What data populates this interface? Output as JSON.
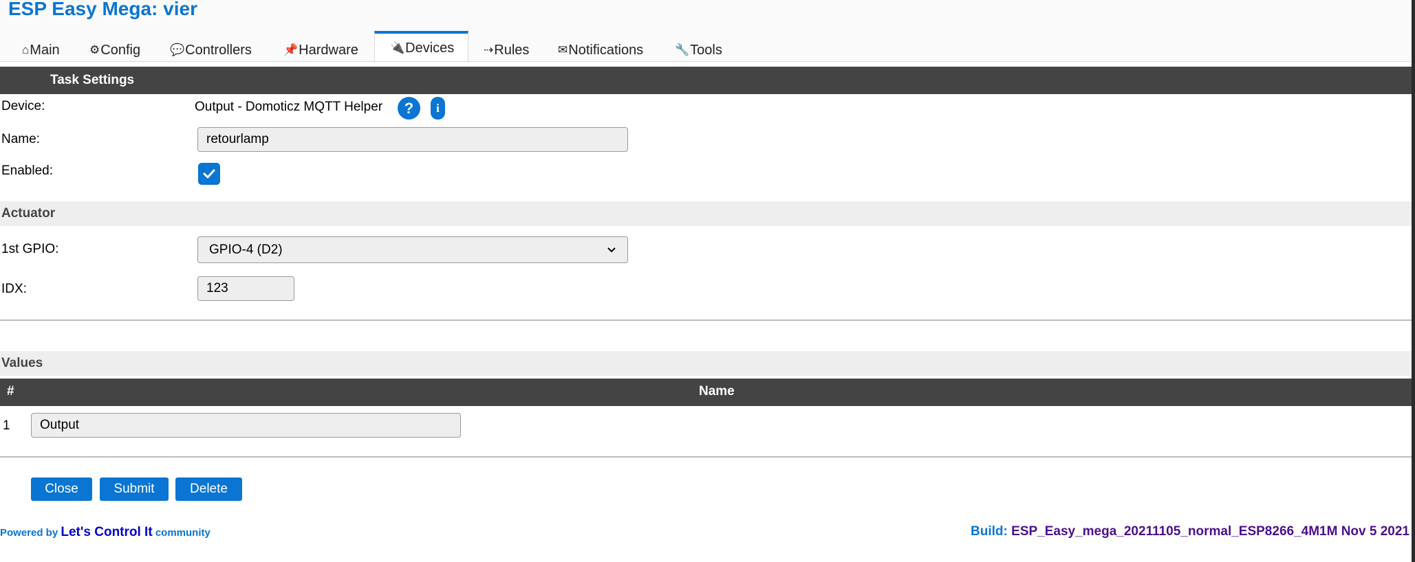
{
  "app": {
    "title": "ESP Easy Mega: vier"
  },
  "tabs": [
    {
      "icon": "⌂",
      "label": "Main"
    },
    {
      "icon": "⚙",
      "label": "Config"
    },
    {
      "icon": "💬",
      "label": "Controllers"
    },
    {
      "icon": "📌",
      "label": "Hardware"
    },
    {
      "icon": "🔌",
      "label": "Devices"
    },
    {
      "icon": "⇢",
      "label": "Rules"
    },
    {
      "icon": "✉",
      "label": "Notifications"
    },
    {
      "icon": "🔧",
      "label": "Tools"
    }
  ],
  "task": {
    "header": "Task Settings",
    "device_label": "Device:",
    "device_value": "Output - Domoticz MQTT Helper",
    "help_icon": "?",
    "info_icon": "i",
    "name_label": "Name:",
    "name_value": "retourlamp",
    "enabled_label": "Enabled:",
    "enabled_checked": true
  },
  "actuator": {
    "header": "Actuator",
    "gpio_label": "1st GPIO:",
    "gpio_value": "GPIO-4 (D2)",
    "idx_label": "IDX:",
    "idx_value": "123"
  },
  "values": {
    "header": "Values",
    "col_hash": "#",
    "col_name": "Name",
    "rows": [
      {
        "num": "1",
        "name": "Output"
      }
    ]
  },
  "buttons": {
    "close": "Close",
    "submit": "Submit",
    "delete": "Delete"
  },
  "footer": {
    "powered_prefix": "Powered by",
    "brand": "Let's Control It",
    "community": "community",
    "build_label": "Build:",
    "build_value": "ESP_Easy_mega_20211105_normal_ESP8266_4M1M Nov 5 2021"
  },
  "colors": {
    "accent": "#0a75d2",
    "dark_bar": "#444444",
    "light_bar": "#eeeeee",
    "build": "#4b0f8c"
  }
}
